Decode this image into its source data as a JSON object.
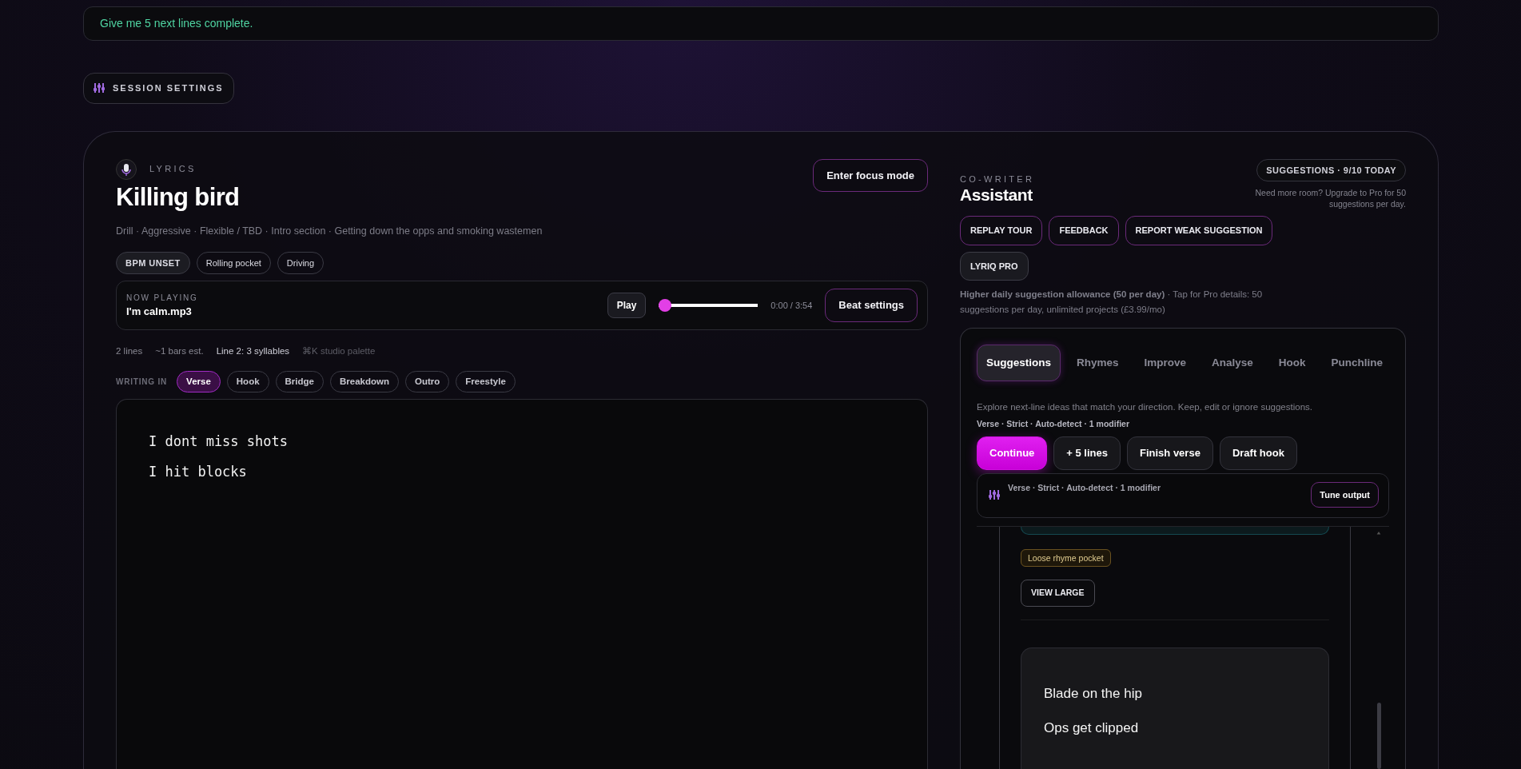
{
  "prompt_bar": {
    "text": "Give me 5 next lines complete."
  },
  "session_settings": {
    "label": "SESSION SETTINGS"
  },
  "lyrics": {
    "eyebrow": "LYRICS",
    "title": "Killing bird",
    "focus_button": "Enter focus mode",
    "subtitle": "Drill · Aggressive · Flexible / TBD · Intro section · Getting down the opps and smoking wastemen",
    "chips": [
      {
        "label": "BPM UNSET",
        "kind": "status"
      },
      {
        "label": "Rolling pocket",
        "kind": "tag"
      },
      {
        "label": "Driving",
        "kind": "tag"
      }
    ],
    "now_playing": {
      "label": "NOW PLAYING",
      "track": "I'm calm.mp3",
      "play_button": "Play",
      "level": 0,
      "time": "0:00 / 3:54",
      "beat_settings": "Beat settings"
    },
    "stats": [
      {
        "text": "2 lines",
        "kind": "muted"
      },
      {
        "text": "~1 bars est.",
        "kind": "muted"
      },
      {
        "text": "Line 2: 3 syllables",
        "kind": "strong"
      },
      {
        "text": "⌘K studio palette",
        "kind": "faint"
      }
    ],
    "writing_in": {
      "label": "WRITING IN",
      "sections": [
        {
          "label": "Verse",
          "selected": true
        },
        {
          "label": "Hook",
          "selected": false
        },
        {
          "label": "Bridge",
          "selected": false
        },
        {
          "label": "Breakdown",
          "selected": false
        },
        {
          "label": "Outro",
          "selected": false
        },
        {
          "label": "Freestyle",
          "selected": false
        }
      ]
    },
    "editor": {
      "lines": [
        "I dont miss shots",
        "I hit blocks"
      ]
    }
  },
  "co_writer": {
    "eyebrow": "CO-WRITER",
    "title": "Assistant",
    "quota": "SUGGESTIONS · 9/10 TODAY",
    "quota_note": "Need more room? Upgrade to Pro for 50 suggestions per day.",
    "buttons": [
      {
        "label": "REPLAY TOUR",
        "kind": "outline"
      },
      {
        "label": "FEEDBACK",
        "kind": "outline"
      },
      {
        "label": "REPORT WEAK SUGGESTION",
        "kind": "outline"
      },
      {
        "label": "LYRIQ PRO",
        "kind": "solid"
      }
    ],
    "pro_note": "**Higher daily suggestion allowance (50 per day)** · Tap for Pro details: 50 suggestions per day, unlimited projects (£3.99/mo)",
    "panel": {
      "tabs": [
        {
          "label": "Suggestions",
          "selected": true
        },
        {
          "label": "Rhymes",
          "selected": false
        },
        {
          "label": "Improve",
          "selected": false
        },
        {
          "label": "Analyse",
          "selected": false
        },
        {
          "label": "Hook",
          "selected": false
        },
        {
          "label": "Punchline",
          "selected": false
        }
      ],
      "description": "Explore next-line ideas that match your direction. Keep, edit or ignore suggestions.",
      "meta": "Verse · Strict · Auto-detect · 1 modifier",
      "actions": [
        {
          "label": "Continue",
          "kind": "primary"
        },
        {
          "label": "+ 5 lines",
          "kind": "secondary"
        },
        {
          "label": "Finish verse",
          "kind": "secondary"
        },
        {
          "label": "Draft hook",
          "kind": "secondary"
        }
      ],
      "tune": {
        "summary": "Verse · Strict · Auto-detect · 1 modifier",
        "button": "Tune output"
      },
      "results": {
        "tag": "Loose rhyme pocket",
        "view_button": "VIEW LARGE",
        "suggestion_lines": [
          "Blade on the hip",
          "Ops get clipped"
        ]
      }
    }
  }
}
